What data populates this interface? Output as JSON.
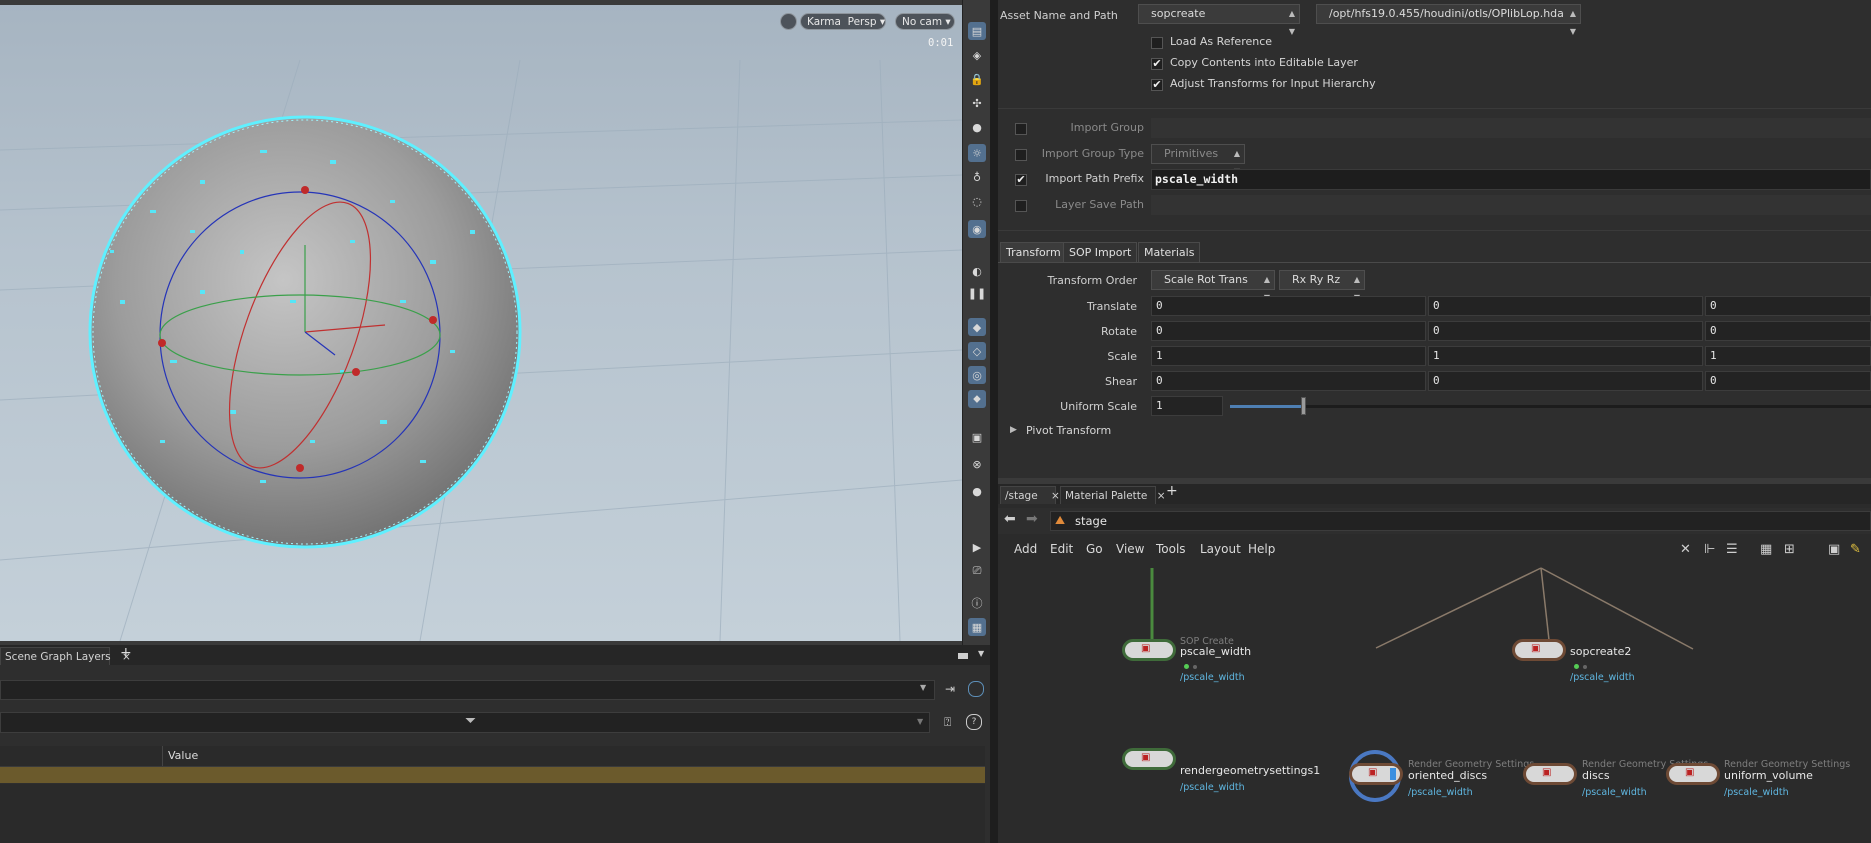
{
  "viewport": {
    "renderer": "Karma",
    "view": "Persp",
    "camera": "No cam",
    "time": "0:01"
  },
  "scene_graph_layers": {
    "tab_label": "Scene Graph Layers",
    "close": "×",
    "add": "+",
    "column_value": "Value"
  },
  "parms": {
    "asset_label": "Asset Name and Path",
    "asset_name": "sopcreate",
    "asset_path": "/opt/hfs19.0.455/houdini/otls/OPlibLop.hda",
    "load_as_reference": "Load As Reference",
    "copy_contents": "Copy Contents into Editable Layer",
    "adjust_transforms": "Adjust Transforms for Input Hierarchy",
    "import_group": "Import Group",
    "import_group_type": "Import Group Type",
    "import_group_type_value": "Primitives",
    "import_path_prefix": "Import Path Prefix",
    "import_path_prefix_value": "pscale_width",
    "layer_save_path": "Layer Save Path",
    "tabs": [
      "Transform",
      "SOP Import",
      "Materials"
    ],
    "transform_order": "Transform Order",
    "transform_order_value": "Scale Rot Trans",
    "rotate_order_value": "Rx Ry Rz",
    "rows": [
      {
        "label": "Translate",
        "values": [
          "0",
          "0",
          "0"
        ]
      },
      {
        "label": "Rotate",
        "values": [
          "0",
          "0",
          "0"
        ]
      },
      {
        "label": "Scale",
        "values": [
          "1",
          "1",
          "1"
        ]
      },
      {
        "label": "Shear",
        "values": [
          "0",
          "0",
          "0"
        ]
      }
    ],
    "uniform_scale": "Uniform Scale",
    "uniform_scale_value": "1",
    "pivot_transform": "Pivot Transform"
  },
  "network": {
    "tabs": [
      {
        "label": "/stage"
      },
      {
        "label": "Material Palette"
      }
    ],
    "close": "×",
    "add": "+",
    "path": "stage",
    "menu": [
      "Add",
      "Edit",
      "Go",
      "View",
      "Tools",
      "Layout",
      "Help"
    ],
    "nodes": {
      "sop_type": "SOP Create",
      "sop_name": "pscale_width",
      "sop_path": "/pscale_width",
      "rgs_name": "rendergeometrysettings1",
      "rgs_path": "/pscale_width",
      "sopcreate2_name": "sopcreate2",
      "sopcreate2_path": "/pscale_width",
      "rgs_type": "Render Geometry Settings",
      "oriented_name": "oriented_discs",
      "oriented_path": "/pscale_width",
      "discs_name": "discs",
      "discs_path": "/pscale_width",
      "volume_name": "uniform_volume",
      "volume_path": "/pscale_width"
    }
  },
  "colors": {
    "accent_blue": "#53708f",
    "node_green": "#3f6b3a",
    "node_brown": "#6e4a35",
    "selection_cyan": "#5ff0ff",
    "table_highlight": "#6b5a2c"
  }
}
